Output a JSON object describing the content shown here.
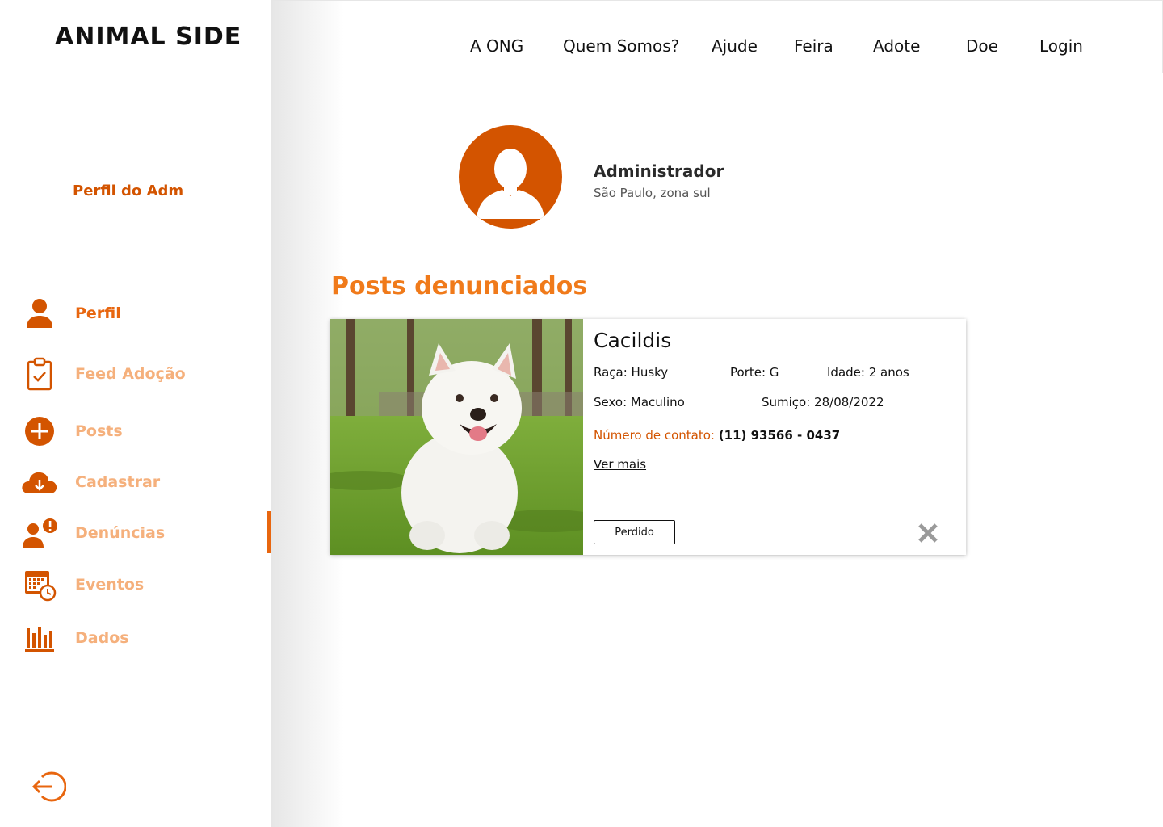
{
  "brand": {
    "logo": "ANIMAL SIDE"
  },
  "sidebar": {
    "title": "Perfil do Adm",
    "items": [
      {
        "label": "Perfil"
      },
      {
        "label": "Feed Adoção"
      },
      {
        "label": "Posts"
      },
      {
        "label": "Cadastrar"
      },
      {
        "label": "Denúncias"
      },
      {
        "label": "Eventos"
      },
      {
        "label": "Dados"
      }
    ]
  },
  "header": {
    "nav": [
      "A ONG",
      "Quem Somos?",
      "Ajude",
      "Feira",
      "Adote",
      "Doe",
      "Login"
    ]
  },
  "profile": {
    "name": "Administrador",
    "location": "São Paulo, zona sul"
  },
  "section": {
    "title": "Posts denunciados"
  },
  "post": {
    "name": "Cacildis",
    "breed": "Raça: Husky",
    "size": "Porte: G",
    "age": "Idade: 2 anos",
    "sex": "Sexo: Maculino",
    "missing": "Sumiço: 28/08/2022",
    "contact_label": "Número de contato:",
    "contact_value": "(11) 93566 - 0437",
    "more": "Ver mais",
    "tag": "Perdido"
  },
  "colors": {
    "accent": "#e8660f",
    "accent_dark": "#d35400",
    "inactive": "#f5b07c"
  }
}
